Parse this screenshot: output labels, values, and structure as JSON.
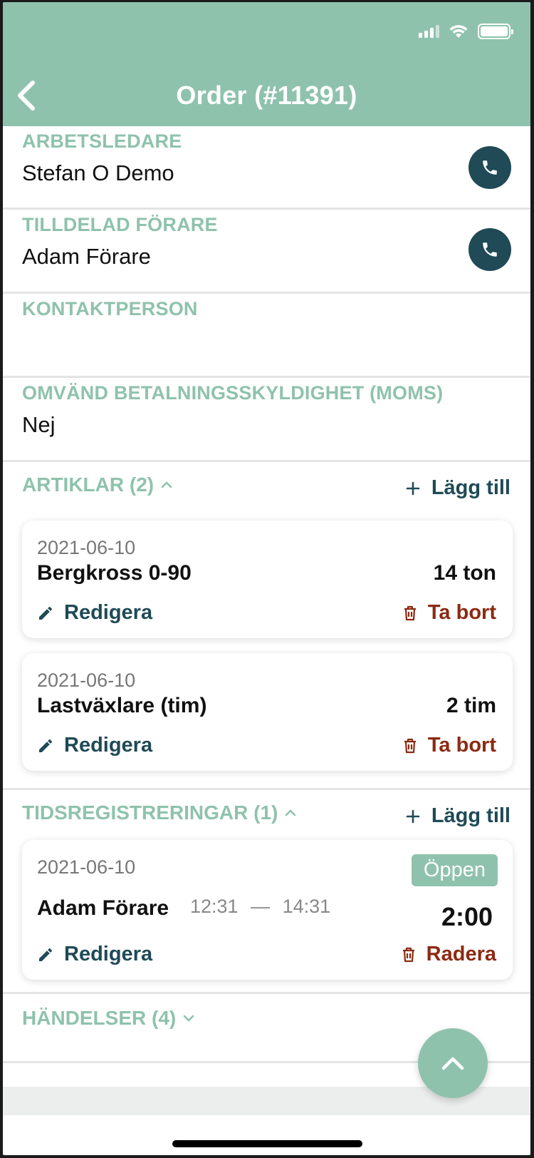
{
  "header": {
    "title": "Order (#11391)",
    "background": "#8fc2ad"
  },
  "fields": {
    "arbetsledare": {
      "label": "ARBETSLEDARE",
      "value": "Stefan O Demo"
    },
    "tilldelad": {
      "label": "TILLDELAD FÖRARE",
      "value": "Adam Förare"
    },
    "kontakt": {
      "label": "KONTAKTPERSON",
      "value": ""
    },
    "moms": {
      "label": "OMVÄND BETALNINGSSKYLDIGHET (MOMS)",
      "value": "Nej"
    }
  },
  "artiklar": {
    "title": "ARTIKLAR (2)",
    "add_label": "Lägg till",
    "items": [
      {
        "date": "2021-06-10",
        "name": "Bergkross 0-90",
        "qty": "14 ton",
        "edit": "Redigera",
        "delete": "Ta bort"
      },
      {
        "date": "2021-06-10",
        "name": "Lastväxlare (tim)",
        "qty": "2 tim",
        "edit": "Redigera",
        "delete": "Ta bort"
      }
    ]
  },
  "tids": {
    "title": "TIDSREGISTRERINGAR (1)",
    "add_label": "Lägg till",
    "items": [
      {
        "date": "2021-06-10",
        "status": "Öppen",
        "name": "Adam Förare",
        "start": "12:31",
        "sep": "—",
        "end": "14:31",
        "duration": "2:00",
        "edit": "Redigera",
        "delete": "Radera"
      }
    ]
  },
  "handelser": {
    "title": "HÄNDELSER (4)"
  },
  "colors": {
    "accent": "#8fc2ad",
    "dark": "#1f4a56",
    "danger": "#8b2a12"
  }
}
